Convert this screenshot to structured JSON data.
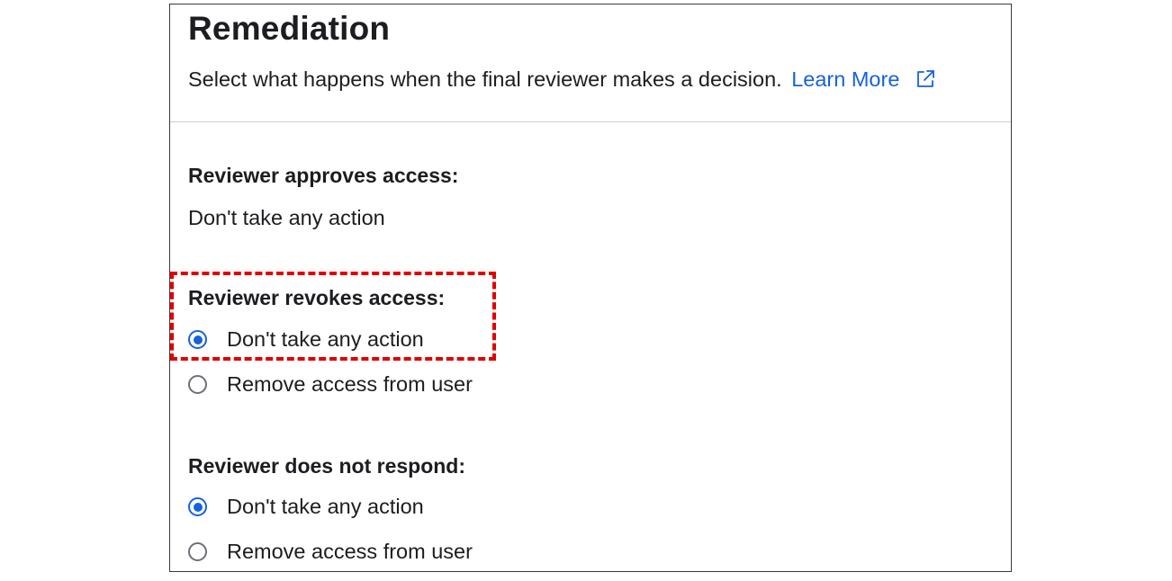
{
  "header": {
    "title": "Remediation",
    "description": "Select what happens when the final reviewer makes a decision.",
    "learn_more": "Learn More",
    "learn_more_icon": "external-link-icon"
  },
  "approves": {
    "label": "Reviewer approves access:",
    "value": "Don't take any action"
  },
  "revokes": {
    "label": "Reviewer revokes access:",
    "options": [
      {
        "label": "Don't take any action",
        "selected": true
      },
      {
        "label": "Remove access from user",
        "selected": false
      }
    ]
  },
  "no_response": {
    "label": "Reviewer does not respond:",
    "options": [
      {
        "label": "Don't take any action",
        "selected": true
      },
      {
        "label": "Remove access from user",
        "selected": false
      }
    ]
  },
  "colors": {
    "accent": "#1662dd",
    "highlight": "#e00000",
    "text": "#1d1d21",
    "border": "#3a3a3a"
  }
}
